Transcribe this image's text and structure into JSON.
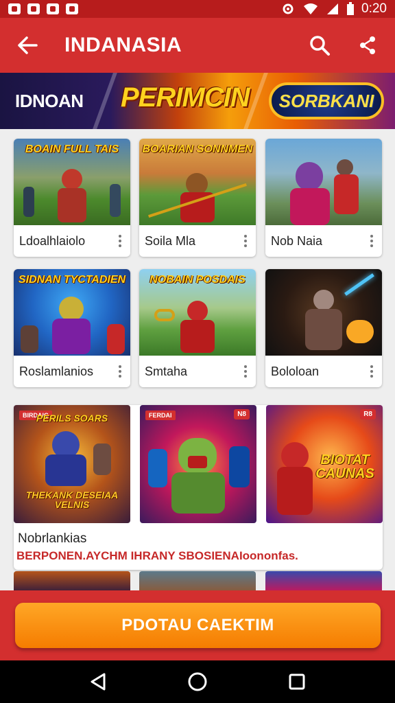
{
  "status_bar": {
    "time": "0:20"
  },
  "app_bar": {
    "title": "INDANASIA"
  },
  "banner": {
    "left_text": "IDNOAN",
    "center_text": "PERIMCIN",
    "right_text": "SORBKANI"
  },
  "games": [
    {
      "label": "Ldoalhlaiolo",
      "thumb_title": "BOAIN FULL TAIS"
    },
    {
      "label": "Soila Mla",
      "thumb_title": "BOARIAN SONNMEN"
    },
    {
      "label": "Nob Naia",
      "thumb_title": ""
    },
    {
      "label": "Roslamlanios",
      "thumb_title": "SIDNAN TYCTADIEN"
    },
    {
      "label": "Smtaha",
      "thumb_title": "NOBAIN POSDAIS"
    },
    {
      "label": "Bololoan",
      "thumb_title": ""
    }
  ],
  "featured": {
    "title": "Nobrlankias",
    "description": "BERPONEN.AYCHM IHRANY SBOSIENAIoononfas.",
    "thumbs": [
      {
        "top_badge": "BIRDAIG",
        "title": "PERILS SOARS",
        "bottom_text": "THEKANK DESEIAA VELNIS"
      },
      {
        "top_badge": "FERDAI",
        "corner_badge": "N8",
        "title": ""
      },
      {
        "corner_badge": "R8",
        "title": "BIOTAT CAUNAS"
      }
    ]
  },
  "cta": {
    "label": "PDOTAU CAEKTIM"
  },
  "colors": {
    "primary": "#d32f2f",
    "status": "#b71c1c",
    "accent": "#f57c00"
  }
}
